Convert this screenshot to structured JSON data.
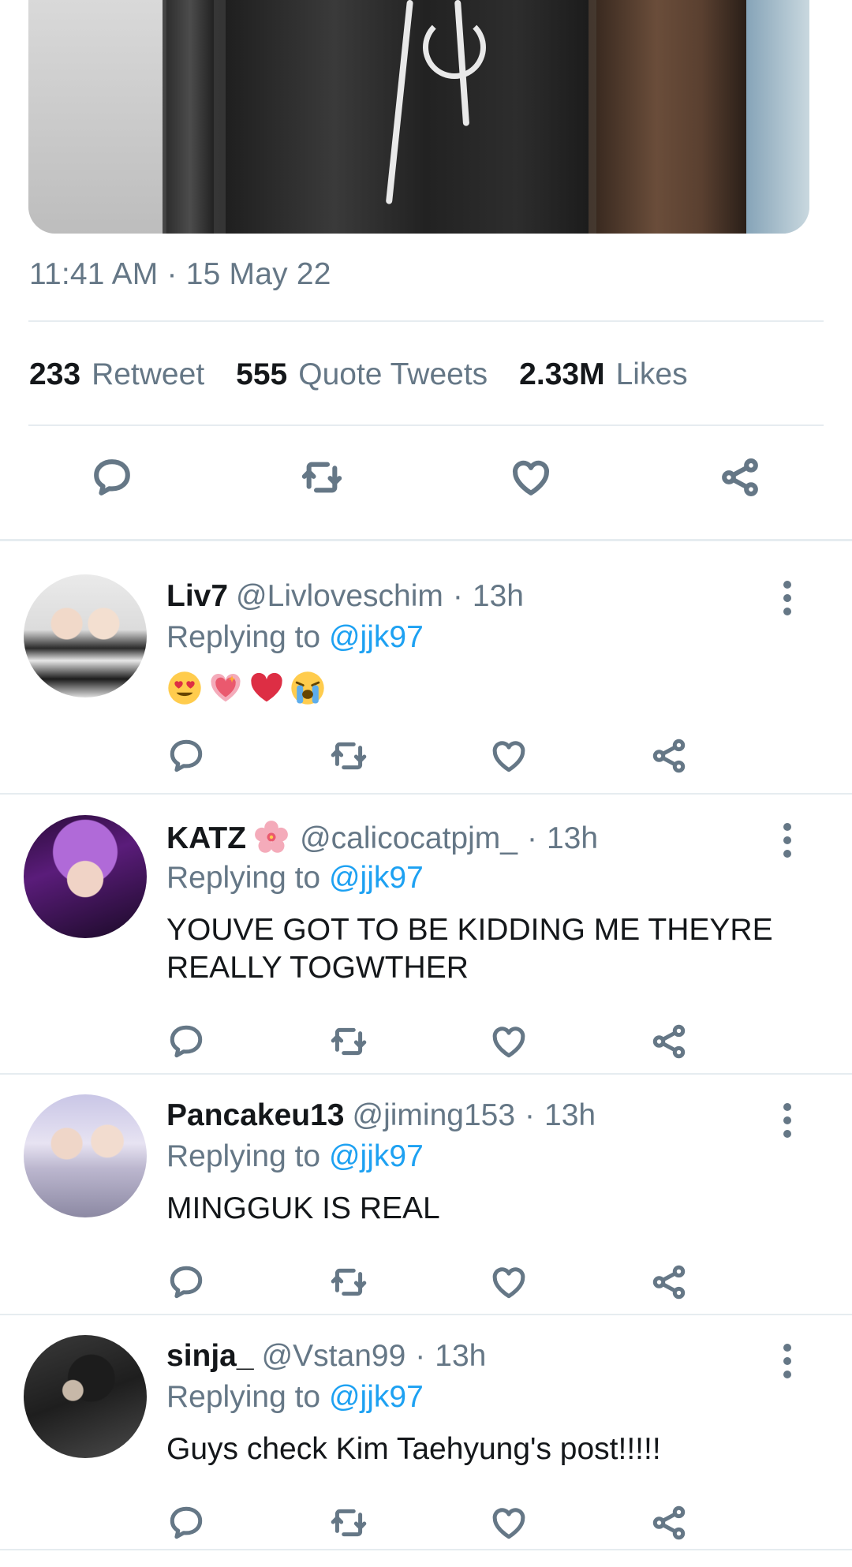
{
  "tweet": {
    "timestamp": "11:41 AM · 15 May 22",
    "stats": [
      {
        "value": "233",
        "label": "Retweet"
      },
      {
        "value": "555",
        "label": "Quote Tweets"
      },
      {
        "value": "2.33M",
        "label": "Likes"
      }
    ],
    "actions": [
      "reply-icon",
      "retweet-icon",
      "like-icon",
      "share-icon"
    ]
  },
  "replies": [
    {
      "name": "Liv7",
      "handle": "@Livloveschim",
      "separator": "·",
      "time": "13h",
      "replying_prefix": "Replying to",
      "replying_to": "@jjk97",
      "text": "",
      "emojis": [
        "heart-eyes",
        "sparkling-heart",
        "red-heart",
        "crying-face"
      ]
    },
    {
      "name": "KATZ",
      "handle": "@calicocatpjm_",
      "separator": "·",
      "time": "13h",
      "replying_prefix": "Replying to",
      "replying_to": "@jjk97",
      "text": "YOUVE GOT TO BE KIDDING ME THEYRE REALLY TOGWTHER"
    },
    {
      "name": "Pancakeu13",
      "handle": "@jiming153",
      "separator": "·",
      "time": "13h",
      "replying_prefix": "Replying to",
      "replying_to": "@jjk97",
      "text": "MINGGUK IS REAL"
    },
    {
      "name": "sinja_",
      "handle": "@Vstan99",
      "separator": "·",
      "time": "13h",
      "replying_prefix": "Replying to",
      "replying_to": "@jjk97",
      "text": "Guys check Kim Taehyung's post!!!!!"
    }
  ],
  "colors": {
    "text": "#14171a",
    "muted": "#657786",
    "link": "#1da1f2",
    "divider": "#e6ecf0"
  }
}
